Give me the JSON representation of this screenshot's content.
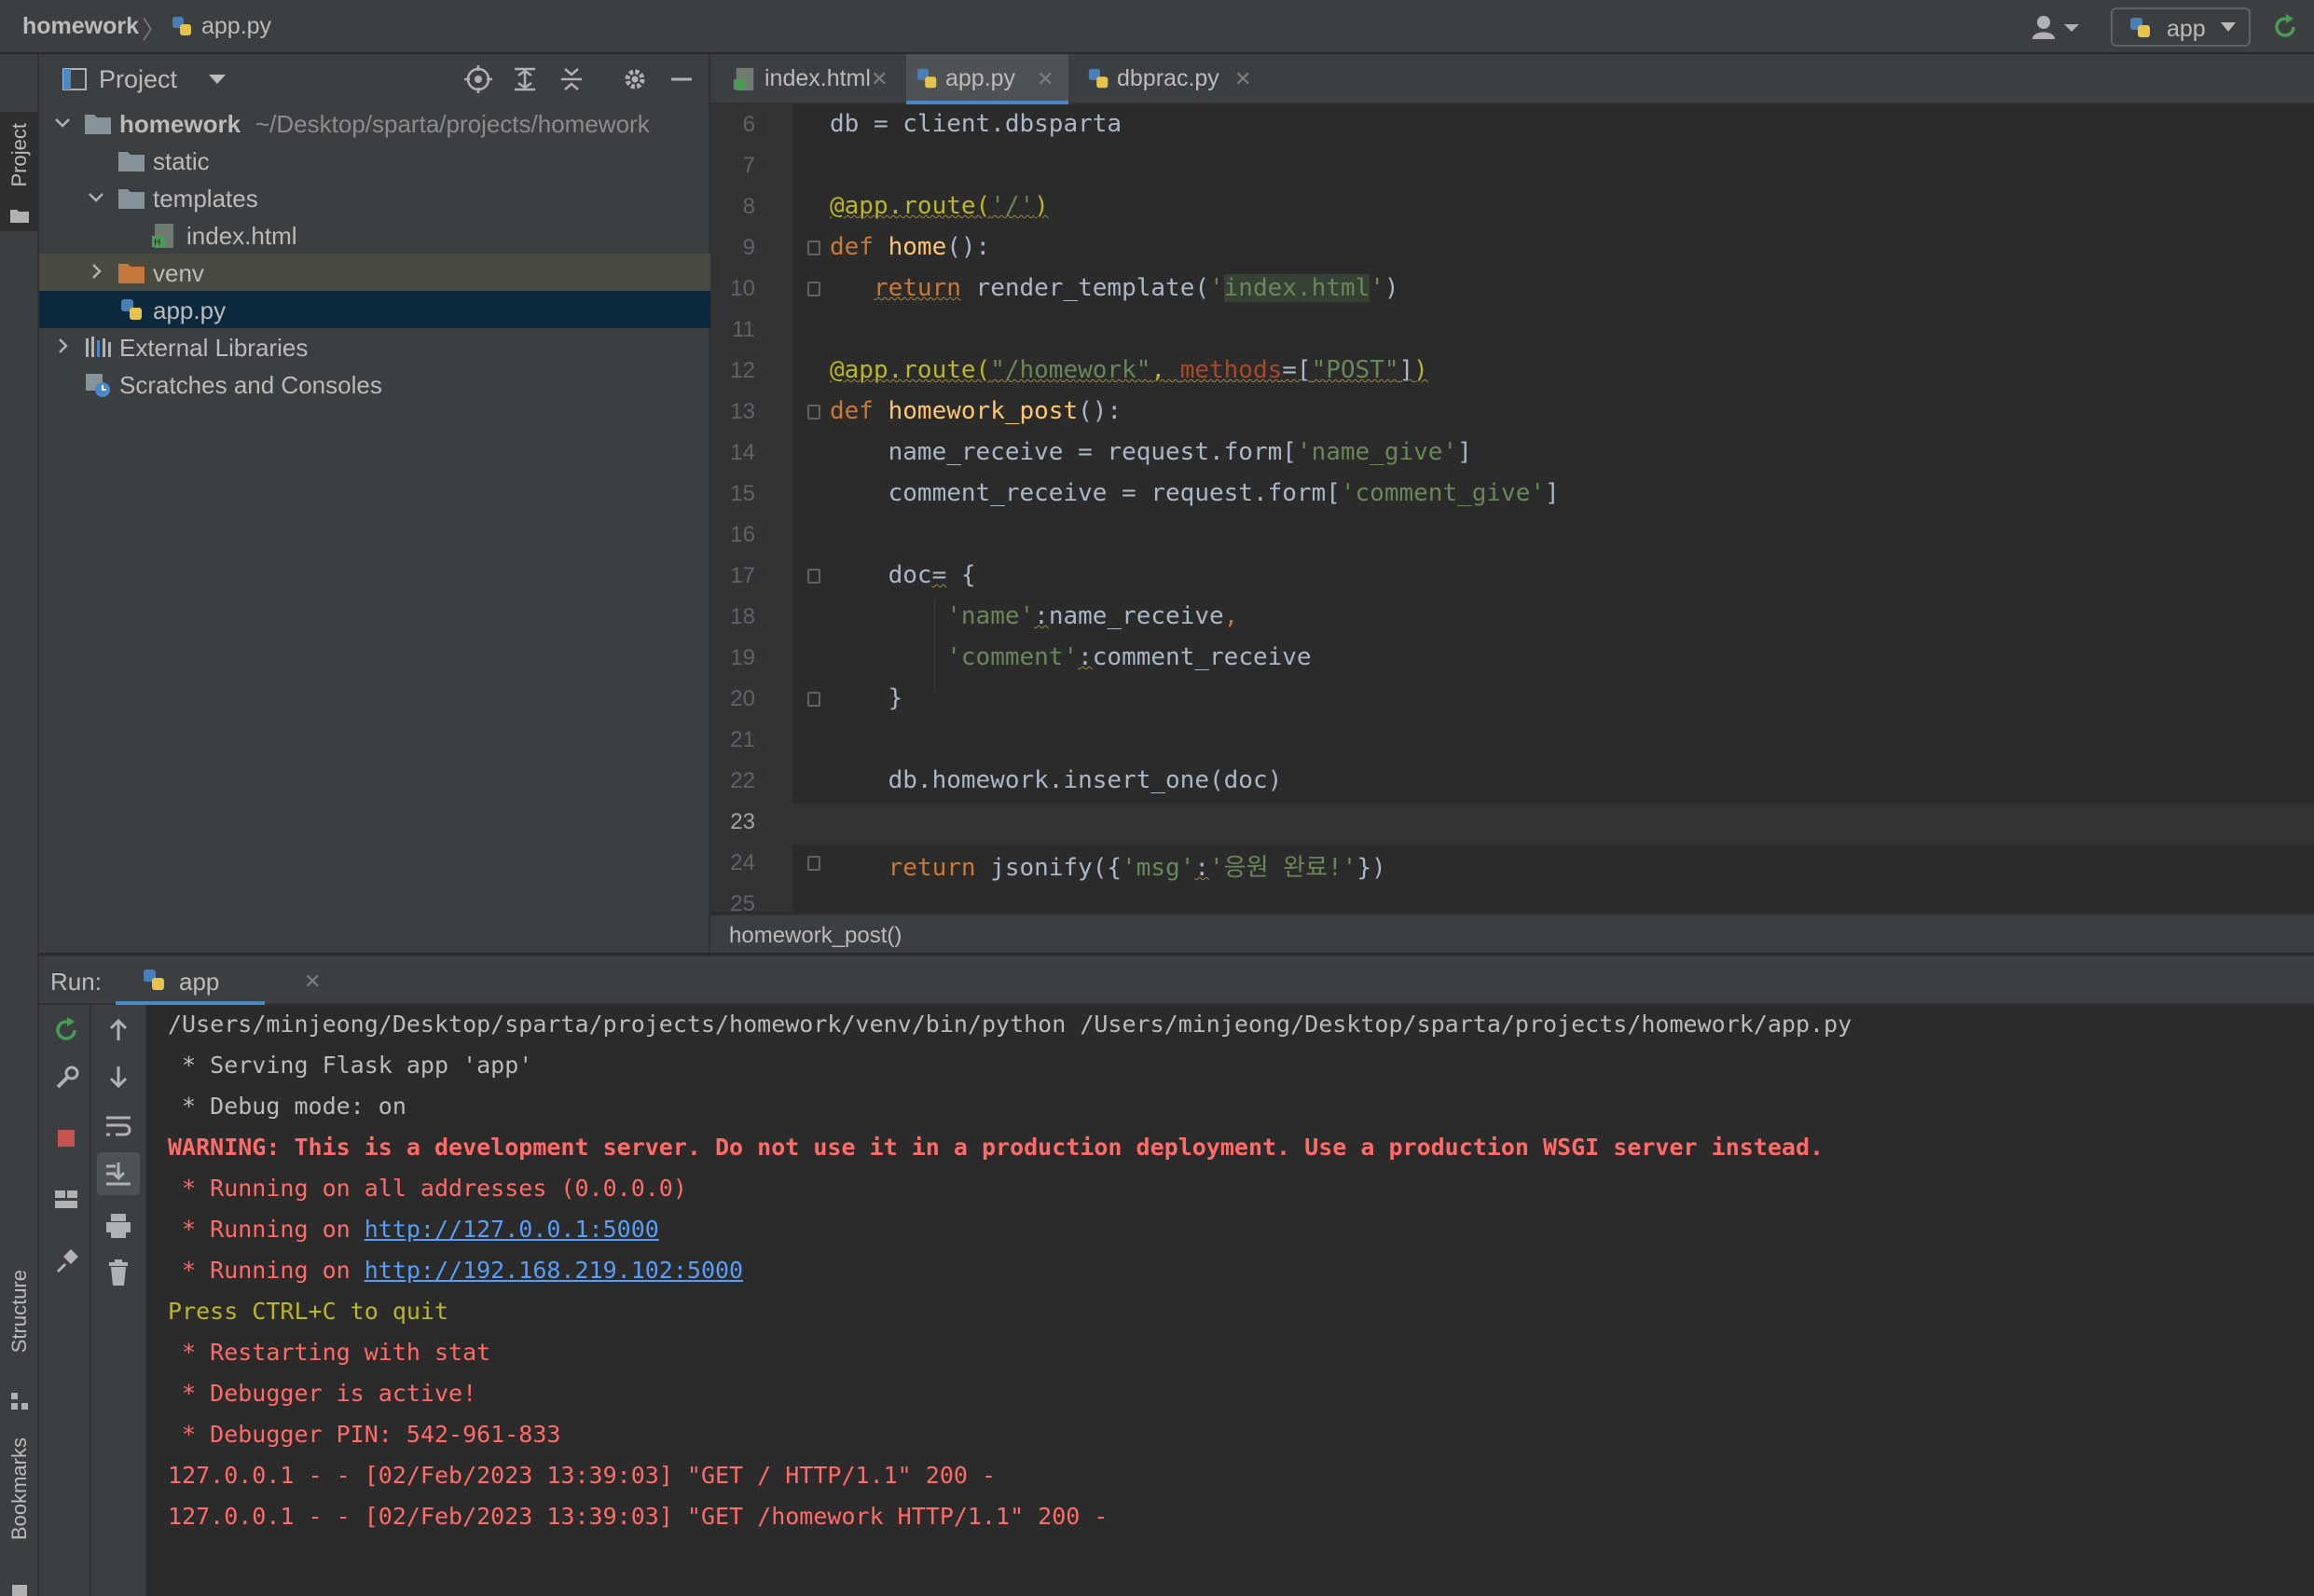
{
  "navbar": {
    "project": "homework",
    "file": "app.py",
    "run_config": "app"
  },
  "left_stripe": {
    "project_tab": "Project",
    "structure_tab": "Structure",
    "bookmarks_tab": "Bookmarks"
  },
  "project_panel": {
    "title": "Project",
    "tree": [
      {
        "label": "homework",
        "sub": "~/Desktop/sparta/projects/homework"
      },
      {
        "label": "static"
      },
      {
        "label": "templates"
      },
      {
        "label": "index.html"
      },
      {
        "label": "venv"
      },
      {
        "label": "app.py"
      },
      {
        "label": "External Libraries"
      },
      {
        "label": "Scratches and Consoles"
      }
    ]
  },
  "tabs": [
    {
      "label": "index.html",
      "active": false
    },
    {
      "label": "app.py",
      "active": true
    },
    {
      "label": "dbprac.py",
      "active": false
    }
  ],
  "editor": {
    "line_numbers": [
      "6",
      "7",
      "8",
      "9",
      "10",
      "11",
      "12",
      "13",
      "14",
      "15",
      "16",
      "17",
      "18",
      "19",
      "20",
      "21",
      "22",
      "23",
      "24",
      "25"
    ],
    "current_line": "23",
    "breadcrumb": "homework_post()"
  },
  "run": {
    "label": "Run:",
    "tab": "app",
    "lines": [
      "/Users/minjeong/Desktop/sparta/projects/homework/venv/bin/python /Users/minjeong/Desktop/sparta/projects/homework/app.py",
      " * Serving Flask app 'app'",
      " * Debug mode: on",
      "WARNING: This is a development server. Do not use it in a production deployment. Use a production WSGI server instead.",
      " * Running on all addresses (0.0.0.0)",
      " * Running on ",
      "http://127.0.0.1:5000",
      " * Running on ",
      "http://192.168.219.102:5000",
      "Press CTRL+C to quit",
      " * Restarting with stat",
      " * Debugger is active!",
      " * Debugger PIN: 542-961-833",
      "127.0.0.1 - - [02/Feb/2023 13:39:03] \"GET / HTTP/1.1\" 200 -",
      "127.0.0.1 - - [02/Feb/2023 13:39:03] \"GET /homework HTTP/1.1\" 200 -"
    ]
  },
  "colors": {
    "accent": "#4a88c7",
    "keyword": "#cc7832",
    "string": "#6a8759",
    "function": "#ffc66d",
    "decorator": "#bbb529",
    "error": "#ff6b68",
    "link": "#589df6"
  }
}
